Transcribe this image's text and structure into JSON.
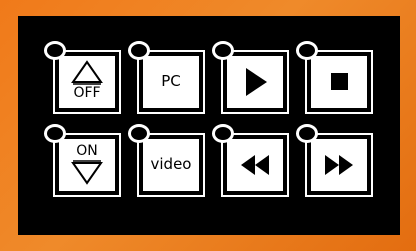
{
  "remote": {
    "row1": {
      "off_label": "OFF",
      "pc_label": "PC"
    },
    "row2": {
      "on_label": "ON",
      "video_label": "video"
    },
    "icons": [
      "arrow-up-icon",
      "play-icon",
      "stop-icon",
      "arrow-down-icon",
      "rewind-icon",
      "fast-forward-icon"
    ],
    "colors": {
      "frame": "#ef8a2a",
      "panel": "#000000",
      "button_face": "#ffffff",
      "glyph": "#000000"
    }
  }
}
